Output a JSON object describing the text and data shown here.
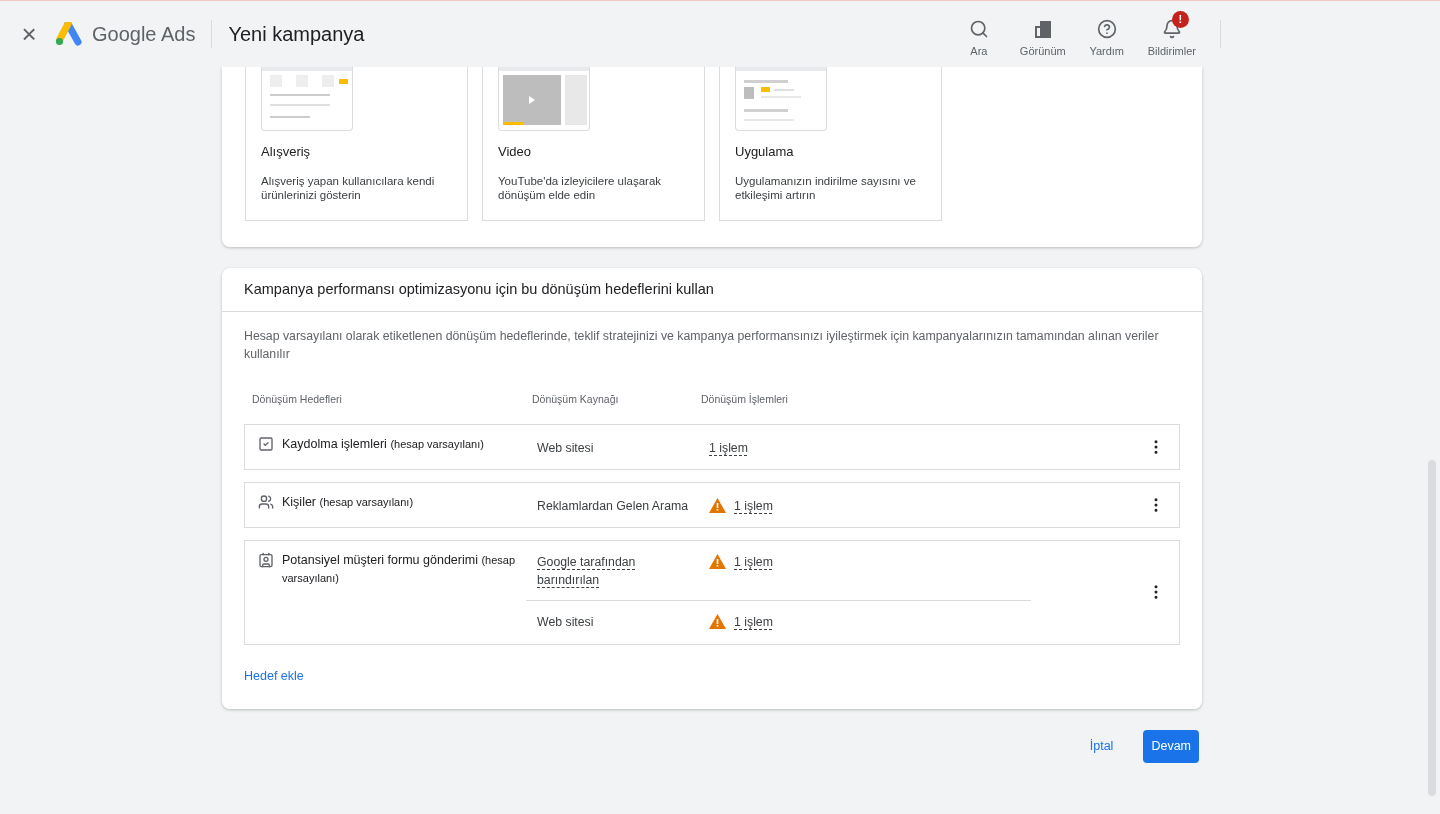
{
  "header": {
    "close": "×",
    "logo_text": "Google Ads",
    "title": "Yeni kampanya",
    "actions": [
      {
        "label": "Ara"
      },
      {
        "label": "Görünüm"
      },
      {
        "label": "Yardım"
      },
      {
        "label": "Bildirimler",
        "badge": "!"
      }
    ]
  },
  "campaign_types": [
    {
      "title": "Alışveriş",
      "description": "Alışveriş yapan kullanıcılara kendi ürünlerinizi gösterin"
    },
    {
      "title": "Video",
      "description": "YouTube'da izleyicilere ulaşarak dönüşüm elde edin"
    },
    {
      "title": "Uygulama",
      "description": "Uygulamanızın indirilme sayısını ve etkileşimi artırın"
    }
  ],
  "goals_card": {
    "title": "Kampanya performansı optimizasyonu için bu dönüşüm hedeflerini kullan",
    "description": "Hesap varsayılanı olarak etiketlenen dönüşüm hedeflerinde, teklif stratejinizi ve kampanya performansınızı iyileştirmek için kampanyalarınızın tamamından alınan veriler kullanılır",
    "columns": [
      "Dönüşüm Hedefleri",
      "Dönüşüm Kaynağı",
      "Dönüşüm İşlemleri"
    ],
    "rows": [
      {
        "name": "Kaydolma işlemleri",
        "note": "(hesap varsayılanı)",
        "sources": [
          {
            "source": "Web sitesi",
            "tooltip": false,
            "actions": "1 işlem",
            "warning": false
          }
        ]
      },
      {
        "name": "Kişiler",
        "note": "(hesap varsayılanı)",
        "sources": [
          {
            "source": "Reklamlardan Gelen Arama",
            "tooltip": false,
            "actions": "1 işlem",
            "warning": true
          }
        ]
      },
      {
        "name": "Potansiyel müşteri formu gönderimi",
        "note": "(hesap varsayılanı)",
        "sources": [
          {
            "source": "Google tarafından barındırılan",
            "tooltip": true,
            "actions": "1 işlem",
            "warning": true
          },
          {
            "source": "Web sitesi",
            "tooltip": false,
            "actions": "1 işlem",
            "warning": true
          }
        ]
      }
    ],
    "add_goal": "Hedef ekle"
  },
  "footer": {
    "cancel": "İptal",
    "continue": "Devam"
  }
}
